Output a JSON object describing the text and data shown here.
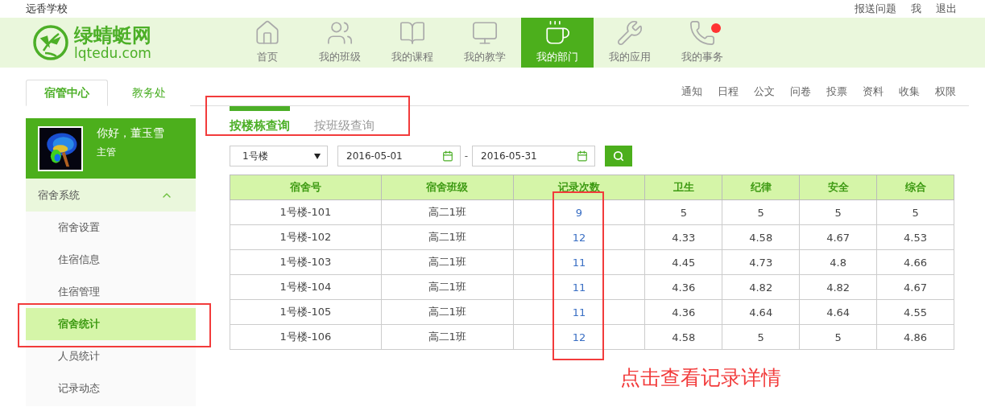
{
  "top_bar": {
    "school": "远香学校",
    "links": [
      "报送问题",
      "我",
      "退出"
    ]
  },
  "logo": {
    "name": "绿蜻蜓网",
    "domain": "lqtedu.com"
  },
  "nav": [
    {
      "label": "首页",
      "selected": false,
      "badge": false
    },
    {
      "label": "我的班级",
      "selected": false,
      "badge": false
    },
    {
      "label": "我的课程",
      "selected": false,
      "badge": false
    },
    {
      "label": "我的教学",
      "selected": false,
      "badge": false
    },
    {
      "label": "我的部门",
      "selected": true,
      "badge": false
    },
    {
      "label": "我的应用",
      "selected": false,
      "badge": false
    },
    {
      "label": "我的事务",
      "selected": false,
      "badge": true
    }
  ],
  "tabs": [
    {
      "label": "宿管中心",
      "selected": true
    },
    {
      "label": "教务处",
      "selected": false
    }
  ],
  "section_links": [
    "通知",
    "日程",
    "公文",
    "问卷",
    "投票",
    "资料",
    "收集",
    "权限"
  ],
  "profile": {
    "greeting": "你好，董玉雪",
    "role": "主管"
  },
  "sidebar": {
    "group": {
      "label": "宿舍系统",
      "expanded": true
    },
    "items": [
      {
        "label": "宿舍设置",
        "selected": false
      },
      {
        "label": "住宿信息",
        "selected": false
      },
      {
        "label": "住宿管理",
        "selected": false
      },
      {
        "label": "宿舍统计",
        "selected": true
      },
      {
        "label": "人员统计",
        "selected": false
      },
      {
        "label": "记录动态",
        "selected": false
      }
    ]
  },
  "subtabs": [
    {
      "label": "按楼栋查询",
      "selected": true
    },
    {
      "label": "按班级查询",
      "selected": false
    }
  ],
  "filters": {
    "building": "1号楼",
    "date_from": "2016-05-01",
    "separator": "-",
    "date_to": "2016-05-31"
  },
  "table": {
    "columns": [
      "宿舍号",
      "宿舍班级",
      "记录次数",
      "卫生",
      "纪律",
      "安全",
      "综合"
    ],
    "rows": [
      [
        "1号楼-101",
        "高二1班",
        "9",
        "5",
        "5",
        "5",
        "5"
      ],
      [
        "1号楼-102",
        "高二1班",
        "12",
        "4.33",
        "4.58",
        "4.67",
        "4.53"
      ],
      [
        "1号楼-103",
        "高二1班",
        "11",
        "4.45",
        "4.73",
        "4.8",
        "4.66"
      ],
      [
        "1号楼-104",
        "高二1班",
        "11",
        "4.36",
        "4.82",
        "4.82",
        "4.67"
      ],
      [
        "1号楼-105",
        "高二1班",
        "11",
        "4.36",
        "4.64",
        "4.64",
        "4.55"
      ],
      [
        "1号楼-106",
        "高二1班",
        "12",
        "4.58",
        "5",
        "5",
        "4.86"
      ]
    ]
  },
  "annotation": {
    "note": "点击查看记录详情"
  }
}
